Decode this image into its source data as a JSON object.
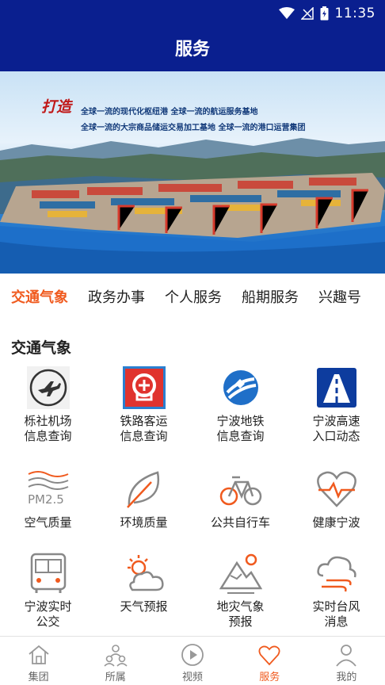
{
  "status_bar": {
    "time": "11:35"
  },
  "header": {
    "title": "服务"
  },
  "banner": {
    "slogan": "打造",
    "line1": "全球一流的现代化枢纽港   全球一流的航运服务基地",
    "line2": "全球一流的大宗商品储运交易加工基地   全球一流的港口运营集团"
  },
  "tabs": [
    {
      "label": "交通气象",
      "active": true
    },
    {
      "label": "政务办事"
    },
    {
      "label": "个人服务"
    },
    {
      "label": "船期服务"
    },
    {
      "label": "兴趣号"
    }
  ],
  "section": {
    "title": "交通气象"
  },
  "services": [
    {
      "label": "栎社机场\n信息查询",
      "icon": "airplane-icon"
    },
    {
      "label": "铁路客运\n信息查询",
      "icon": "railway-icon"
    },
    {
      "label": "宁波地铁\n信息查询",
      "icon": "metro-icon"
    },
    {
      "label": "宁波高速\n入口动态",
      "icon": "highway-icon"
    },
    {
      "label": "空气质量",
      "icon": "air-quality-icon"
    },
    {
      "label": "环境质量",
      "icon": "leaf-icon"
    },
    {
      "label": "公共自行车",
      "icon": "bicycle-icon"
    },
    {
      "label": "健康宁波",
      "icon": "heart-pulse-icon"
    },
    {
      "label": "宁波实时\n公交",
      "icon": "bus-icon"
    },
    {
      "label": "天气预报",
      "icon": "weather-icon"
    },
    {
      "label": "地灾气象\n预报",
      "icon": "mountain-icon"
    },
    {
      "label": "实时台风\n消息",
      "icon": "typhoon-icon"
    }
  ],
  "bottom_nav": [
    {
      "label": "集团",
      "icon": "home-icon"
    },
    {
      "label": "所属",
      "icon": "org-icon"
    },
    {
      "label": "视频",
      "icon": "play-icon"
    },
    {
      "label": "服务",
      "icon": "heart-icon",
      "active": true
    },
    {
      "label": "我的",
      "icon": "person-icon"
    }
  ],
  "colors": {
    "header": "#0a1f8f",
    "accent": "#f05a1e"
  }
}
